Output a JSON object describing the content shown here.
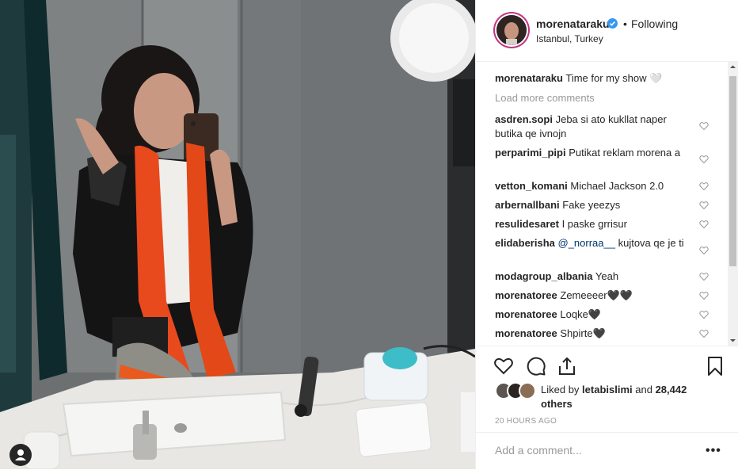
{
  "post": {
    "username": "morenataraku",
    "follow_status": "Following",
    "separator": "•",
    "location": "Istanbul, Turkey"
  },
  "caption": {
    "username": "morenataraku",
    "text": "Time for my show 🤍"
  },
  "load_more_label": "Load more comments",
  "comments": [
    {
      "username": "asdren.sopi",
      "text": "Jeba si ato kukllat naper butika qe ivnojn"
    },
    {
      "username": "perparimi_pipi",
      "text": "Putikat reklam morena a"
    },
    {
      "username": "vetton_komani",
      "text": "Michael Jackson 2.0"
    },
    {
      "username": "arbernallbani",
      "text": "Fake yeezys"
    },
    {
      "username": "resulidesaret",
      "text": "I paske grrisur"
    },
    {
      "username": "elidaberisha",
      "mention": "@_norraa__",
      "text": "kujtova qe je ti"
    },
    {
      "username": "modagroup_albania",
      "text": "Yeah"
    },
    {
      "username": "morenatoree",
      "text": "Zemeeeer🖤🖤"
    },
    {
      "username": "morenatoree",
      "text": "Loqke🖤"
    },
    {
      "username": "morenatoree",
      "text": "Shpirte🖤"
    }
  ],
  "likes": {
    "prefix": "Liked by",
    "user": "letabislimi",
    "and": "and",
    "others": "28,442 others"
  },
  "timestamp": "20 HOURS AGO",
  "add_comment": {
    "placeholder": "Add a comment..."
  },
  "more_label": "•••",
  "icons": {
    "heart": "heart-icon",
    "comment": "comment-bubble-icon",
    "share": "share-icon",
    "save": "bookmark-icon",
    "verified": "verified-badge-icon",
    "user": "user-silhouette-icon"
  },
  "colors": {
    "verified": "#3897f0",
    "avatar_ring": "#c13584",
    "muted": "#999999",
    "text": "#262626",
    "border": "#efefef"
  }
}
